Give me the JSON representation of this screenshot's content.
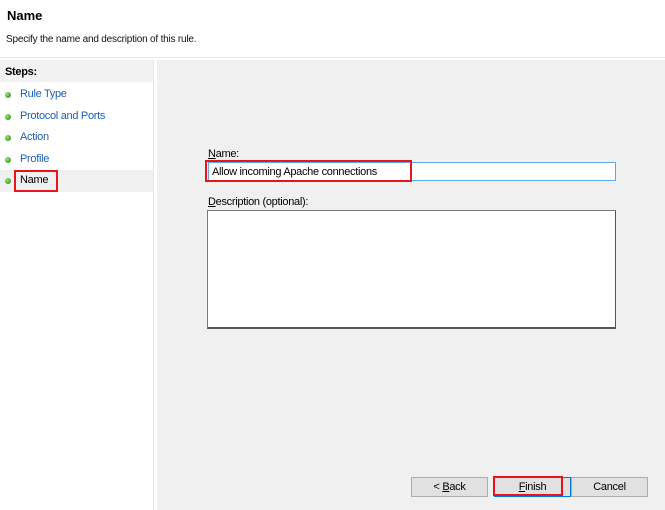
{
  "header": {
    "title": "Name",
    "subtitle": "Specify the name and description of this rule."
  },
  "steps": {
    "title": "Steps:",
    "items": [
      {
        "label": "Rule Type",
        "status": "complete"
      },
      {
        "label": "Protocol and Ports",
        "status": "complete"
      },
      {
        "label": "Action",
        "status": "complete"
      },
      {
        "label": "Profile",
        "status": "complete"
      },
      {
        "label": "Name",
        "status": "current"
      }
    ]
  },
  "form": {
    "name_label_mnemonic": "N",
    "name_label_rest": "ame:",
    "name_value": "Allow incoming Apache connections",
    "description_label_mnemonic": "D",
    "description_label_rest": "escription (optional):",
    "description_value": ""
  },
  "buttons": {
    "back_prefix": "< ",
    "back_mnemonic": "B",
    "back_rest": "ack",
    "finish_mnemonic": "F",
    "finish_rest": "inish",
    "cancel": "Cancel"
  },
  "colors": {
    "highlight": "#e8141b",
    "link": "#1a5fb4",
    "focus_border": "#5ea8e6"
  }
}
